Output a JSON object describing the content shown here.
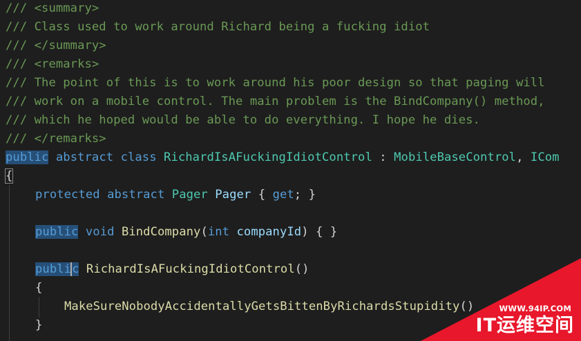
{
  "code": {
    "l1": "/// <summary>",
    "l2": "/// Class used to work around Richard being a fucking idiot",
    "l3": "/// </summary>",
    "l4": "/// <remarks>",
    "l5": "/// The point of this is to work around his poor design so that paging will",
    "l6": "/// work on a mobile control. The main problem is the BindCompany() method,",
    "l7": "/// which he hoped would be able to do everything. I hope he dies.",
    "l8": "/// </remarks>",
    "l9": {
      "kw_public": "public",
      "kw_abstract": "abstract",
      "kw_class": "class",
      "class_name": "RichardIsAFuckingIdiotControl",
      "colon": ":",
      "base": "MobileBaseControl",
      "comma": ",",
      "iface": "ICom"
    },
    "l10": "{",
    "l11": {
      "kw_protected": "protected",
      "kw_abstract": "abstract",
      "type": "Pager",
      "name": "Pager",
      "open": "{",
      "get": "get",
      "close": "; }"
    },
    "l13": {
      "kw_public": "public",
      "kw_void": "void",
      "method": "BindCompany",
      "open": "(",
      "kw_int": "int",
      "param": "companyId",
      "close": ") { }"
    },
    "l15": {
      "kw_publ": "publ",
      "kw_i": "i",
      "kw_c": "c",
      "ctor": "RichardIsAFuckingIdiotControl",
      "parens": "()"
    },
    "l16": "{",
    "l17": {
      "call": "MakeSureNobodyAccidentallyGetsBittenByRichardsStupidity",
      "parens": "()"
    },
    "l18": "}"
  },
  "watermark": {
    "url": "WWW.94IP.COM",
    "brand": "IT运维空间",
    "color": "#e8172b"
  }
}
